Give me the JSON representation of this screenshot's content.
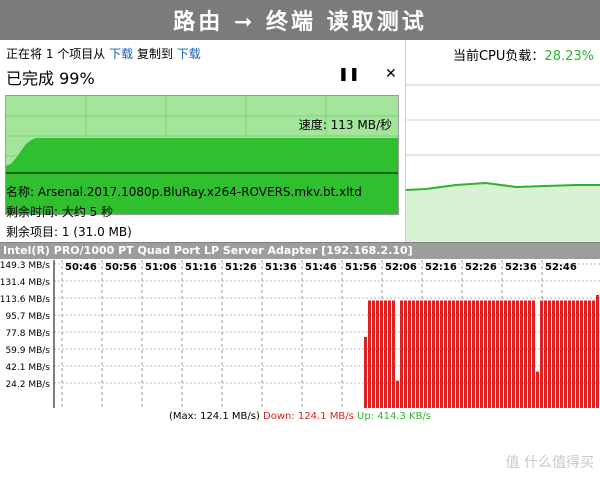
{
  "banner": {
    "title": "路由 ➞ 终端 读取测试"
  },
  "copy_dialog": {
    "line1_prefix": "正在将 1 个项目从",
    "from": "下载",
    "line1_middle": "复制到",
    "to": "下载",
    "progress_text": "已完成 99%",
    "progress_value": 0.99,
    "speed_label": "速度: 113 MB/秒",
    "name_line": "名称: Arsenal.2017.1080p.BluRay.x264-ROVERS.mkv.bt.xltd",
    "time_line": "剩余时间: 大约 5 秒",
    "items_line": "剩余项目: 1 (31.0 MB)"
  },
  "cpu": {
    "label": "当前CPU负载：",
    "value": "28.23%"
  },
  "network": {
    "adapter": "Intel(R) PRO/1000 PT Quad Port LP Server Adapter [192.168.2.10]",
    "y_ticks": [
      "149.3 MB/s",
      "131.4 MB/s",
      "113.6 MB/s",
      "95.7 MB/s",
      "77.8 MB/s",
      "59.9 MB/s",
      "42.1 MB/s",
      "24.2 MB/s"
    ],
    "x_ticks": [
      "50:46",
      "50:56",
      "51:06",
      "51:16",
      "51:26",
      "51:36",
      "51:46",
      "51:56",
      "52:06",
      "52:16",
      "52:26",
      "52:36",
      "52:46"
    ],
    "footer_max": "(Max: 124.1 MB/s)",
    "footer_down": "Down: 124.1 MB/s",
    "footer_up": "Up: 414.3 KB/s"
  },
  "colors": {
    "bar": "#e02020",
    "speed_fill": "#2fbf2f",
    "speed_bg": "#a3e59a",
    "cpu_fill": "#d8f3d3",
    "cpu_line": "#2fb32f"
  },
  "watermark": "值 什么值得买"
}
